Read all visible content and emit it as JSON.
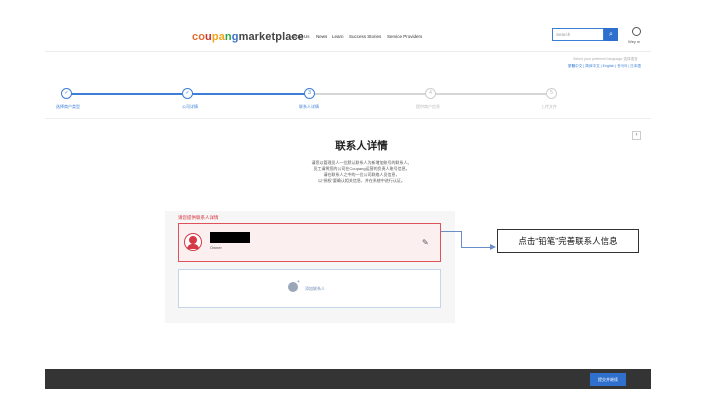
{
  "header": {
    "logo": {
      "p1": "co",
      "p2": "u",
      "p3": "pa",
      "p4": "n",
      "p5": "g",
      "p6": "marketplace"
    },
    "nav": [
      {
        "label": "About Us"
      },
      {
        "label": "News"
      },
      {
        "label": "Learn"
      },
      {
        "label": "Success Stories"
      },
      {
        "label": "Service Providers"
      }
    ],
    "search": {
      "placeholder": "Search"
    },
    "user_label": "Wey w",
    "lang_hint": "Select your preferred language 选择语言",
    "lang_options": "繁體中文 | 简体中文 | English | 한국어 | 日本語"
  },
  "stepper": {
    "steps": [
      {
        "label": "选择商户类型",
        "state": "done",
        "mark": "✓"
      },
      {
        "label": "公司详情",
        "state": "done",
        "mark": "✓"
      },
      {
        "label": "联系人详情",
        "state": "current",
        "mark": "3"
      },
      {
        "label": "提供商户信息",
        "state": "todo",
        "mark": "4"
      },
      {
        "label": "上传文件",
        "state": "todo",
        "mark": "5"
      }
    ],
    "active_color": "#3d7ed6",
    "inactive_color": "#cfcfcf"
  },
  "main": {
    "title": "联系人详情",
    "desc": [
      "请您以管理员人一位默认联系人为新增加账号的联系人。",
      "员工请将您的公司在Coupang运营的负责人账号信息。",
      "请在联系人之中的一位公司联络人员信息，",
      "以“授权”要确认相关信息，并在系统中进行认证。"
    ],
    "section_label": "请您提供联系人详情",
    "contact": {
      "role": "Owner"
    },
    "add_contact": "添加联系人"
  },
  "annotation": {
    "text": "点击“铅笔”完善联系人信息"
  },
  "footer": {
    "button": "提交并继续"
  },
  "icons": {
    "search": "search-icon",
    "user": "user-icon",
    "edit": "pencil-icon",
    "next": "chevron-right-icon",
    "add": "add-person-icon",
    "avatar": "avatar-icon"
  },
  "colors": {
    "accent": "#2f6fce",
    "danger": "#d8313b",
    "footer_bg": "#343434"
  }
}
